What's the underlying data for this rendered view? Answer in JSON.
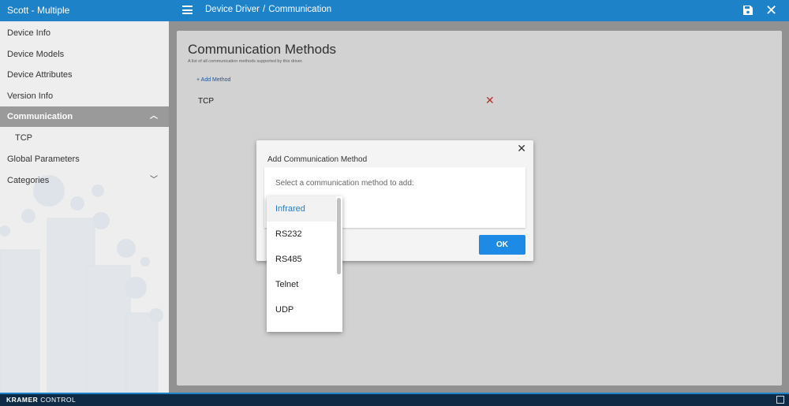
{
  "app": {
    "title": "Scott - Multiple"
  },
  "breadcrumb": {
    "parent": "Device Driver",
    "separator": "/",
    "current": "Communication"
  },
  "sidebar": {
    "items": [
      {
        "label": "Device Info"
      },
      {
        "label": "Device Models"
      },
      {
        "label": "Device Attributes"
      },
      {
        "label": "Version Info"
      },
      {
        "label": "Communication"
      },
      {
        "label": "TCP"
      },
      {
        "label": "Global Parameters"
      },
      {
        "label": "Categories"
      }
    ]
  },
  "main": {
    "title": "Communication Methods",
    "subtitle": "A list of all communication methods supported by this driver.",
    "add_label": "+ Add Method",
    "methods": [
      {
        "name": "TCP"
      }
    ]
  },
  "modal": {
    "title": "Add Communication Method",
    "prompt": "Select a communication method to add:",
    "ok_label": "OK",
    "options": [
      {
        "label": "Infrared",
        "selected": true
      },
      {
        "label": "RS232"
      },
      {
        "label": "RS485"
      },
      {
        "label": "Telnet"
      },
      {
        "label": "UDP"
      }
    ]
  },
  "footer": {
    "brand_bold": "KRAMER",
    "brand_rest": "CONTROL"
  },
  "colors": {
    "accent": "#1d82c8",
    "delete": "#d32f2f",
    "ok_button": "#1d8ae6"
  },
  "icons": {
    "menu": "hamburger-icon",
    "save": "save-icon",
    "close": "close-icon",
    "delete": "delete-x-icon",
    "chevron_up": "chevron-up-icon",
    "chevron_down": "chevron-down-icon"
  }
}
